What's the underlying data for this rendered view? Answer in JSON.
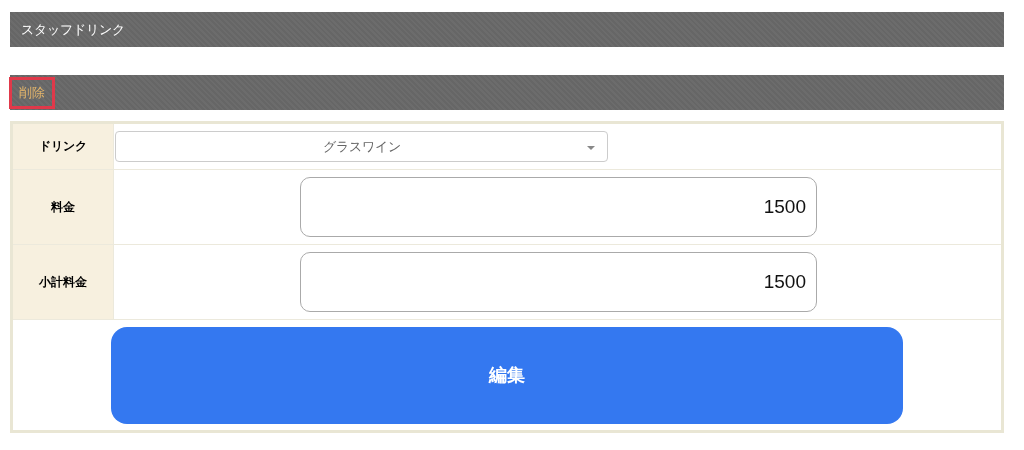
{
  "header": {
    "title": "スタッフドリンク"
  },
  "toolbar": {
    "delete_link": {
      "label": "削除",
      "highlighted": true
    }
  },
  "form": {
    "rows": [
      {
        "kind": "select",
        "label": "ドリンク",
        "value": "グラスワイン"
      },
      {
        "kind": "input",
        "label": "料金",
        "value": "1500"
      },
      {
        "kind": "input",
        "label": "小計料金",
        "value": "1500"
      }
    ],
    "submit": {
      "label": "編集"
    }
  }
}
